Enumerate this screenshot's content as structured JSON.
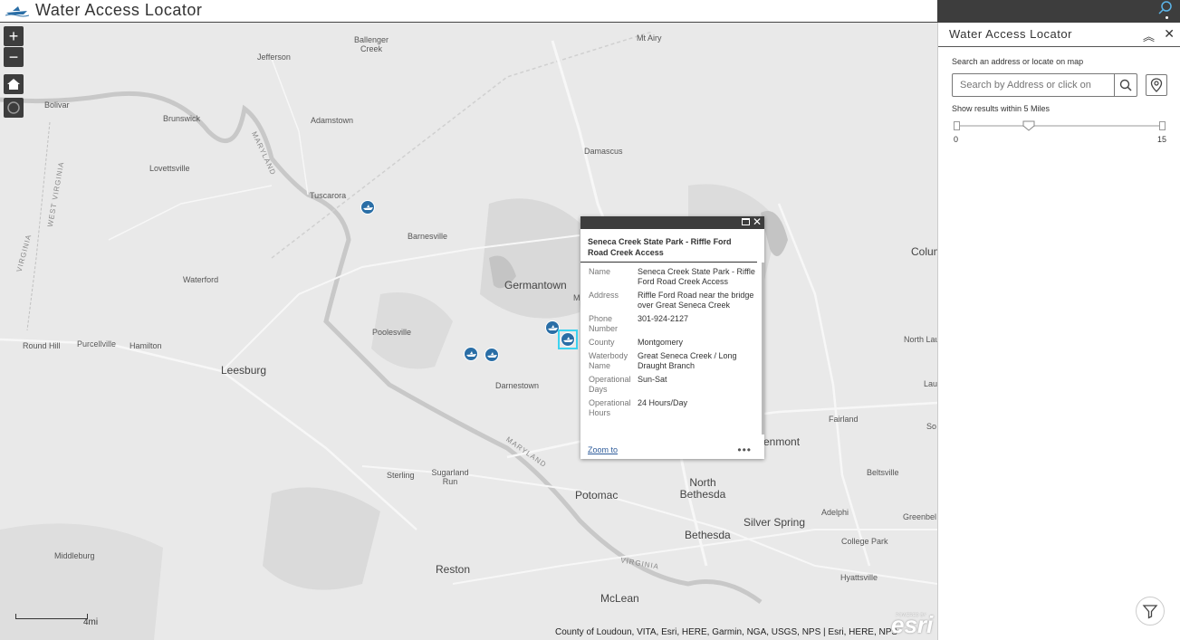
{
  "header": {
    "title": "Water Access Locator"
  },
  "map": {
    "zoom_in_label": "+",
    "zoom_out_label": "−",
    "labels": {
      "mt_airy": "Mt Airy",
      "ballenger_creek": "Ballenger Creek",
      "jefferson": "Jefferson",
      "bolivar": "Bolivar",
      "brunswick": "Brunswick",
      "adamstown": "Adamstown",
      "lovettsville": "Lovettsville",
      "tuscarora": "Tuscarora",
      "damascus": "Damascus",
      "barnesville": "Barnesville",
      "waterford": "Waterford",
      "germantown": "Germantown",
      "poolesville": "Poolesville",
      "round_hill": "Round Hill",
      "purcellville": "Purcellville",
      "hamilton": "Hamilton",
      "leesburg": "Leesburg",
      "darnestown": "Darnestown",
      "sterling": "Sterling",
      "sugarland_run": "Sugarland Run",
      "potomac": "Potomac",
      "north_bethesda": "North Bethesda",
      "bethesda": "Bethesda",
      "silver_spring": "Silver Spring",
      "middleburg": "Middleburg",
      "reston": "Reston",
      "mclean": "McLean",
      "fairland": "Fairland",
      "beltsville": "Beltsville",
      "adelphi": "Adelphi",
      "college_park": "College Park",
      "greenbelt": "Greenbel",
      "hyattsville": "Hyattsville",
      "columbia": "Colum",
      "north_laurel": "North Lau",
      "laurel": "Lau",
      "south": "So",
      "enmont": "enmont",
      "m_partial": "M",
      "west_virginia": "WEST VIRGINIA",
      "virginia_w": "VIRGINIA",
      "maryland": "MARYLAND",
      "virginia_s": "VIRGINIA",
      "maryland_s": "MARYLAND"
    },
    "scale_label": "4mi",
    "attribution": "County of Loudoun, VITA, Esri, HERE, Garmin, NGA, USGS, NPS | Esri, HERE, NPS",
    "powered_by": "POWERED BY",
    "esri": "esri"
  },
  "popup": {
    "title": "Seneca Creek State Park - Riffle Ford Road Creek Access",
    "rows": [
      {
        "key": "Name",
        "value": "Seneca Creek State Park - Riffle Ford Road Creek Access"
      },
      {
        "key": "Address",
        "value": "Riffle Ford Road near the bridge over Great Seneca Creek"
      },
      {
        "key": "Phone Number",
        "value": "301-924-2127"
      },
      {
        "key": "County",
        "value": "Montgomery"
      },
      {
        "key": "Waterbody Name",
        "value": "Great Seneca Creek / Long Draught Branch"
      },
      {
        "key": "Operational Days",
        "value": "Sun-Sat"
      },
      {
        "key": "Operational Hours",
        "value": "24 Hours/Day"
      }
    ],
    "zoom_to": "Zoom to",
    "more": "•••"
  },
  "panel": {
    "title": "Water Access Locator",
    "search_label": "Search an address or locate on map",
    "search_placeholder": "Search by Address or click on",
    "radius_label": "Show results within 5 Miles",
    "slider_min": "0",
    "slider_max": "15",
    "slider_value": 5
  },
  "colors": {
    "accent_dark": "#3d3d3d",
    "marker": "#2a6ea6",
    "selection": "#3dd3f0",
    "link": "#2d5b9a"
  }
}
